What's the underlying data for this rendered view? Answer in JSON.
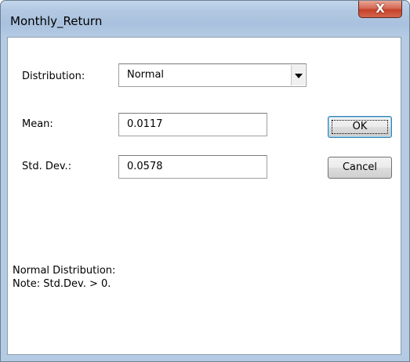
{
  "window": {
    "title": "Monthly_Return",
    "close_glyph": "X"
  },
  "form": {
    "distribution_label": "Distribution:",
    "distribution_value": "Normal",
    "mean_label": "Mean:",
    "mean_value": "0.0117",
    "stddev_label": "Std. Dev.:",
    "stddev_value": "0.0578"
  },
  "buttons": {
    "ok_label": "OK",
    "cancel_label": "Cancel"
  },
  "note": {
    "line1": "Normal Distribution:",
    "line2": "Note: Std.Dev. > 0."
  },
  "colors": {
    "title_bar": "#b3c9e3",
    "close_button": "#c7412a",
    "default_button_border": "#3c7fb1"
  },
  "icons": {
    "close": "close-icon",
    "dropdown": "chevron-down-icon"
  }
}
